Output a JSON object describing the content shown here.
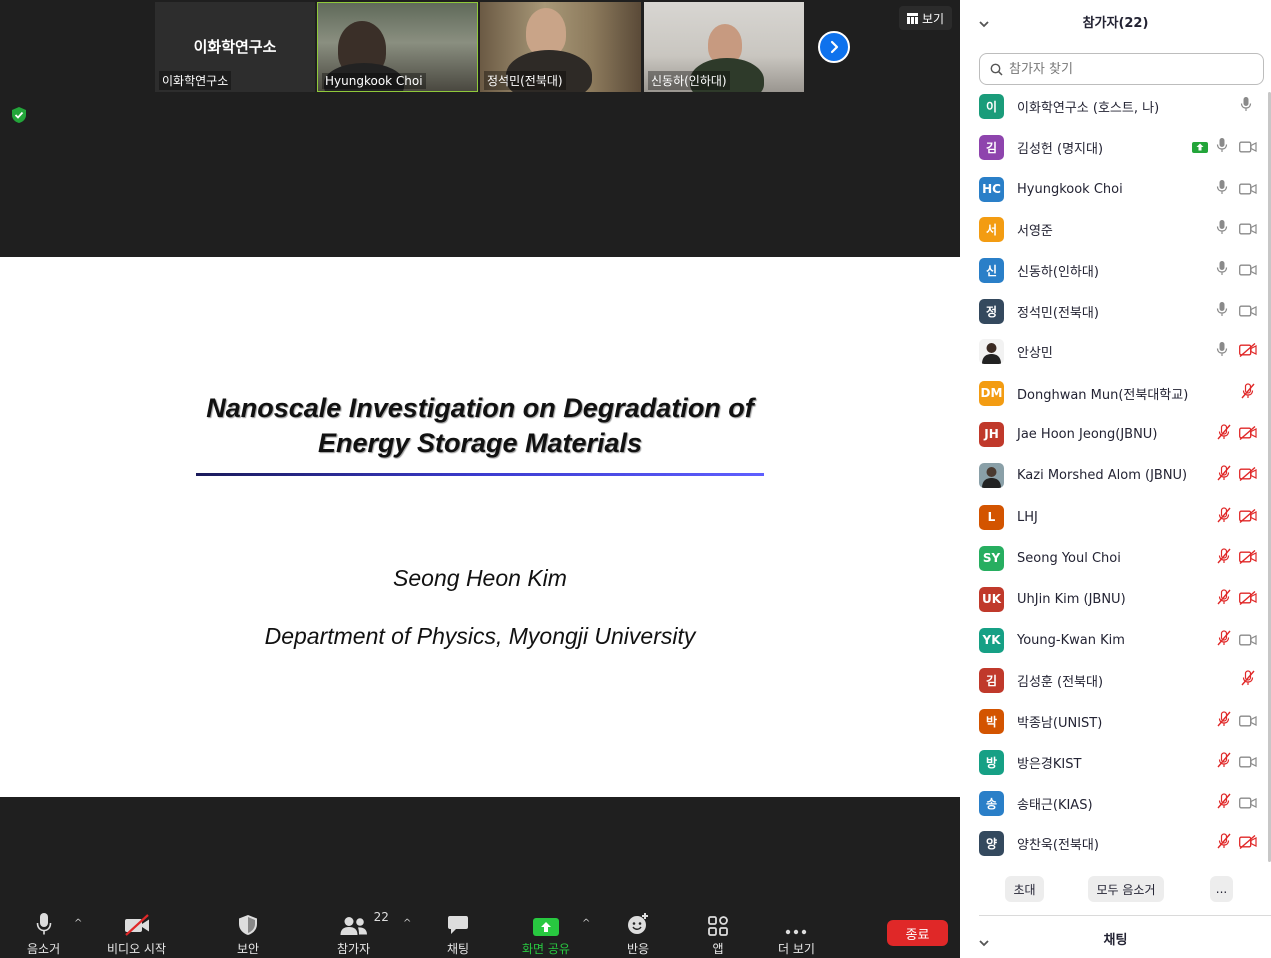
{
  "videos": [
    {
      "name": "이화학연구소",
      "display": "이화학연구소"
    },
    {
      "name": "Hyungkook Choi"
    },
    {
      "name": "정석민(전북대)"
    },
    {
      "name": "신동하(인하대)"
    }
  ],
  "view_button": "보기",
  "slide": {
    "title_line1": "Nanoscale Investigation on Degradation of",
    "title_line2": "Energy Storage Materials",
    "author": "Seong Heon Kim",
    "department": "Department of Physics, Myongji University"
  },
  "toolbar": {
    "mute": "음소거",
    "video": "비디오 시작",
    "security": "보안",
    "participants": "참가자",
    "participants_count": "22",
    "chat": "채팅",
    "share": "화면 공유",
    "reactions": "반응",
    "apps": "앱",
    "more": "더 보기",
    "end": "종료"
  },
  "panel": {
    "title": "참가자(22)",
    "search_placeholder": "참가자 찾기",
    "participants": [
      {
        "initial": "이",
        "name": "이화학연구소 (호스트, 나)",
        "color": "#1a9c7a",
        "mic": "on",
        "cam": "none"
      },
      {
        "initial": "김",
        "name": "김성헌 (명지대)",
        "color": "#8e44ad",
        "mic": "on",
        "cam": "on",
        "sharing": true
      },
      {
        "initial": "HC",
        "name": "Hyungkook Choi",
        "color": "#2a7fc8",
        "mic": "on",
        "cam": "on"
      },
      {
        "initial": "서",
        "name": "서영준",
        "color": "#f39c12",
        "mic": "on",
        "cam": "on"
      },
      {
        "initial": "신",
        "name": "신동하(인하대)",
        "color": "#2a7fc8",
        "mic": "on",
        "cam": "on"
      },
      {
        "initial": "정",
        "name": "정석민(전북대)",
        "color": "#34495e",
        "mic": "on",
        "cam": "on"
      },
      {
        "initial": "",
        "name": "안상민",
        "color": "photo",
        "mic": "on",
        "cam": "off"
      },
      {
        "initial": "DM",
        "name": "Donghwan Mun(전북대학교)",
        "color": "#f39c12",
        "mic": "off",
        "cam": "none"
      },
      {
        "initial": "JH",
        "name": "Jae Hoon Jeong(JBNU)",
        "color": "#c0392b",
        "mic": "off",
        "cam": "off"
      },
      {
        "initial": "",
        "name": "Kazi Morshed Alom (JBNU)",
        "color": "photo2",
        "mic": "off",
        "cam": "off"
      },
      {
        "initial": "L",
        "name": "LHJ",
        "color": "#d35400",
        "mic": "off",
        "cam": "off"
      },
      {
        "initial": "SY",
        "name": "Seong Youl Choi",
        "color": "#27ae60",
        "mic": "off",
        "cam": "off"
      },
      {
        "initial": "UK",
        "name": "UhJin Kim (JBNU)",
        "color": "#c0392b",
        "mic": "off",
        "cam": "off"
      },
      {
        "initial": "YK",
        "name": "Young-Kwan Kim",
        "color": "#16a085",
        "mic": "off",
        "cam": "on"
      },
      {
        "initial": "김",
        "name": "김성훈 (전북대)",
        "color": "#c0392b",
        "mic": "off",
        "cam": "none"
      },
      {
        "initial": "박",
        "name": "박종남(UNIST)",
        "color": "#d35400",
        "mic": "off",
        "cam": "on"
      },
      {
        "initial": "방",
        "name": "방은경KIST",
        "color": "#16a085",
        "mic": "off",
        "cam": "on"
      },
      {
        "initial": "송",
        "name": "송태근(KIAS)",
        "color": "#2a7fc8",
        "mic": "off",
        "cam": "on"
      },
      {
        "initial": "양",
        "name": "양찬욱(전북대)",
        "color": "#34495e",
        "mic": "off",
        "cam": "off"
      }
    ],
    "footer": {
      "invite": "초대",
      "mute_all": "모두 음소거",
      "more": "..."
    },
    "chat_title": "채팅"
  },
  "colors": {
    "accent_blue": "#0e72ed",
    "end_red": "#e02828",
    "share_green": "#28c840",
    "muted_red": "#e02828"
  }
}
